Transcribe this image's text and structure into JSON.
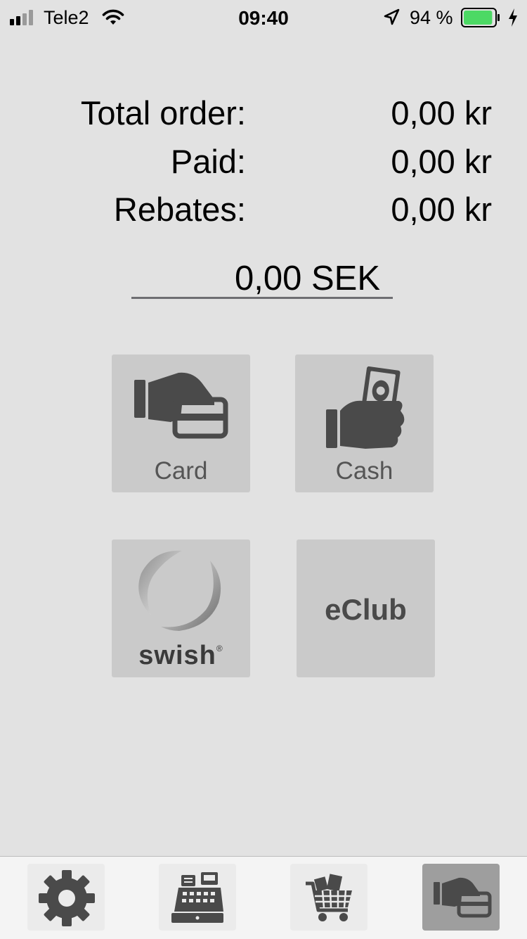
{
  "status_bar": {
    "carrier": "Tele2",
    "time": "09:40",
    "battery": "94 %",
    "icons": [
      "signal-icon",
      "wifi-icon",
      "location-arrow-icon",
      "battery-icon",
      "charging-bolt-icon"
    ],
    "battery_level": 0.94,
    "battery_color": "#4cd964"
  },
  "summary": {
    "total_order_label": "Total order:",
    "total_order_value": "0,00 kr",
    "paid_label": "Paid:",
    "paid_value": "0,00 kr",
    "rebates_label": "Rebates:",
    "rebates_value": "0,00 kr"
  },
  "amount": {
    "value": "0,00 SEK"
  },
  "payment_methods": {
    "card_label": "Card",
    "cash_label": "Cash",
    "swish_label": "swish",
    "swish_mark": "®",
    "eclub_label": "eClub",
    "icons": [
      "hand-card-icon",
      "hand-cash-icon",
      "swish-logo-icon"
    ]
  },
  "tab_bar": {
    "tabs": [
      {
        "icon": "gear-icon",
        "active": false
      },
      {
        "icon": "cash-register-icon",
        "active": false
      },
      {
        "icon": "shopping-cart-icon",
        "active": false
      },
      {
        "icon": "hand-card-icon",
        "active": true
      }
    ]
  },
  "colors": {
    "background": "#e2e2e2",
    "tile": "#cacaca",
    "icon": "#4a4a4a",
    "active_tab": "#9e9e9e",
    "tab_bar": "#f4f4f4"
  }
}
